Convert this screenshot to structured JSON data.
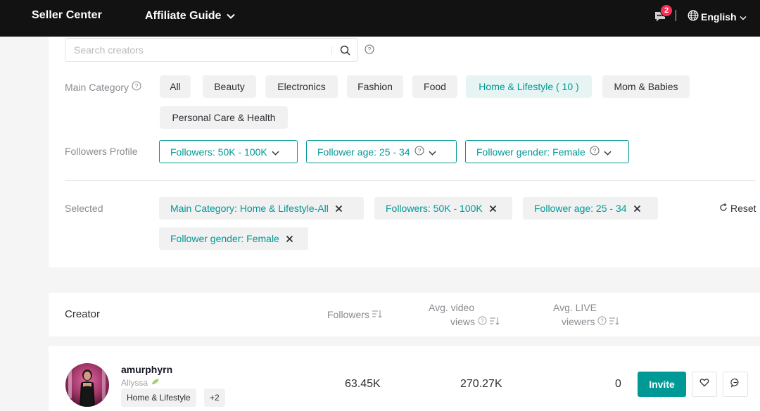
{
  "header": {
    "brand": "Seller Center",
    "guide_label": "Affiliate Guide",
    "message_count": "2",
    "language": "English"
  },
  "search": {
    "placeholder": "Search creators",
    "value": ""
  },
  "main_category": {
    "label": "Main Category",
    "options": [
      "All",
      "Beauty",
      "Electronics",
      "Fashion",
      "Food",
      "Home & Lifestyle ( 10 )",
      "Mom & Babies",
      "Personal Care & Health"
    ],
    "selected": "Home & Lifestyle ( 10 )"
  },
  "followers_profile": {
    "label": "Followers Profile",
    "followers": "Followers: 50K - 100K",
    "age": "Follower age: 25 - 34",
    "gender": "Follower gender: Female"
  },
  "selected": {
    "label": "Selected",
    "chips": [
      "Main Category: Home & Lifestyle-All",
      "Followers: 50K - 100K",
      "Follower age: 25 - 34",
      "Follower gender: Female"
    ],
    "reset_label": "Reset"
  },
  "table": {
    "headers": {
      "creator": "Creator",
      "followers": "Followers",
      "video_views_1": "Avg. video",
      "video_views_2": "views",
      "live_viewers_1": "Avg. LIVE",
      "live_viewers_2": "viewers"
    },
    "rows": [
      {
        "username": "amurphyrn",
        "display_name": "Allyssa",
        "category_tag": "Home & Lifestyle",
        "more_tag": "+2",
        "followers": "63.45K",
        "avg_video_views": "270.27K",
        "avg_live_viewers": "0",
        "invite_label": "Invite"
      }
    ]
  },
  "colors": {
    "accent": "#009995",
    "accent_bg": "#e6f5f4",
    "topbar": "#121212",
    "badge": "#fe2c55"
  },
  "icons": [
    "chevron-down-icon",
    "message-icon",
    "globe-icon",
    "search-icon",
    "help-icon",
    "close-icon",
    "reset-icon",
    "sort-icon",
    "heart-icon",
    "chat-icon",
    "leaf-icon"
  ]
}
